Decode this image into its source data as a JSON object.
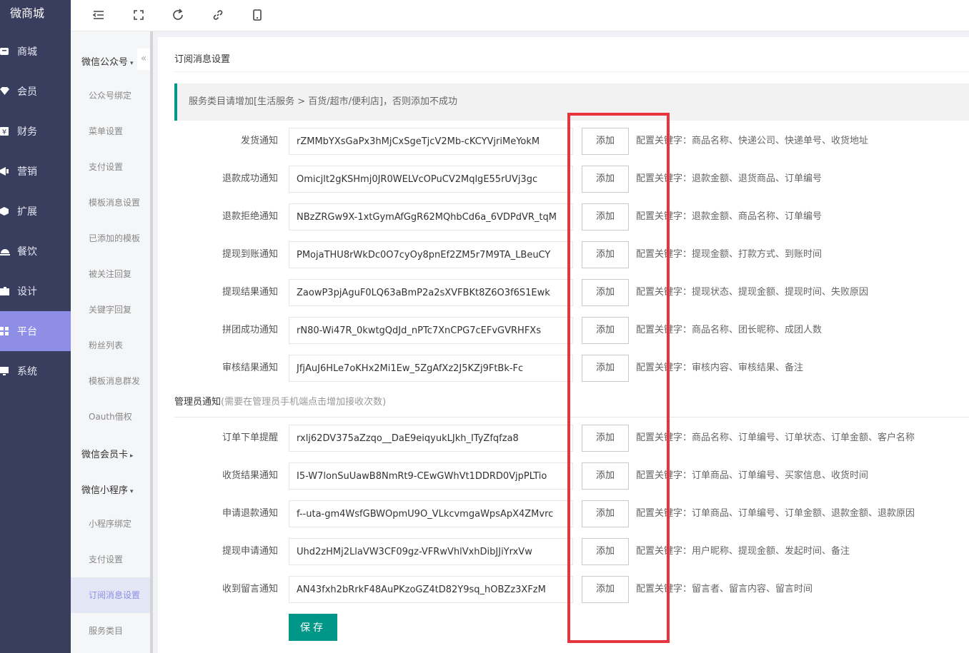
{
  "nav": {
    "brand": "微商城",
    "items": [
      {
        "label": "商城",
        "icon": "shop-icon"
      },
      {
        "label": "会员",
        "icon": "member-icon"
      },
      {
        "label": "财务",
        "icon": "finance-icon"
      },
      {
        "label": "营销",
        "icon": "marketing-icon"
      },
      {
        "label": "扩展",
        "icon": "extension-icon"
      },
      {
        "label": "餐饮",
        "icon": "catering-icon"
      },
      {
        "label": "设计",
        "icon": "design-icon"
      },
      {
        "label": "平台",
        "icon": "platform-icon",
        "active": true
      },
      {
        "label": "系统",
        "icon": "system-icon"
      }
    ]
  },
  "submenu": {
    "groups": [
      {
        "label": "微信公众号",
        "caret": "▾"
      },
      {
        "label": "微信会员卡",
        "caret": "▸"
      },
      {
        "label": "微信小程序",
        "caret": "▾"
      }
    ],
    "items": [
      "公众号绑定",
      "菜单设置",
      "支付设置",
      "模板消息设置",
      "已添加的模板",
      "被关注回复",
      "关键字回复",
      "粉丝列表",
      "模板消息群发",
      "Oauth借权",
      "小程序绑定",
      "支付设置",
      "订阅消息设置",
      "服务类目"
    ],
    "active_index": 12,
    "collapse_icon": "«"
  },
  "page": {
    "title": "订阅消息设置",
    "alert": "服务类目请增加[生活服务 > 百货/超市/便利店]，否则添加不成功",
    "add_label": "添加",
    "save_label": "保存",
    "section2_title": "管理员通知",
    "section2_hint": "(需要在管理员手机端点击增加接收次数)"
  },
  "user_notifications": [
    {
      "label": "发货通知",
      "value": "rZMMbYXsGaPx3hMjCxSgeTjcV2Mb-cKCYVjriMeYokM",
      "keywords": "配置关键字：商品名称、快递公司、快递单号、收货地址"
    },
    {
      "label": "退款成功通知",
      "value": "Omicjlt2gKSHmj0JR0WELVcOPuCV2MqlgE55rUVj3gc",
      "keywords": "配置关键字：退款金额、退货商品、订单编号"
    },
    {
      "label": "退款拒绝通知",
      "value": "NBzZRGw9X-1xtGymAfGgR62MQhbCd6a_6VDPdVR_tqM",
      "keywords": "配置关键字：退款金额、商品名称、订单编号"
    },
    {
      "label": "提现到账通知",
      "value": "PMojaTHU8rWkDc0O7cyOy8pnEf2ZM5r7M9TA_LBeuCY",
      "keywords": "配置关键字：提现金额、打款方式、到账时间"
    },
    {
      "label": "提现结果通知",
      "value": "ZaowP3pjAguF0LQ63aBmP2a2sXVFBKt8Z6O3f6S1Ewk",
      "keywords": "配置关键字：提现状态、提现金额、提现时间、失败原因"
    },
    {
      "label": "拼团成功通知",
      "value": "rN80-Wi47R_0kwtgQdJd_nPTc7XnCPG7cEFvGVRHFXs",
      "keywords": "配置关键字：商品名称、团长昵称、成团人数"
    },
    {
      "label": "审核结果通知",
      "value": "JfjAuJ6HLe7oKHx2Mi1Ew_5ZgAfXz2J5KZj9FtBk-Fc",
      "keywords": "配置关键字：审核内容、审核结果、备注"
    }
  ],
  "admin_notifications": [
    {
      "label": "订单下单提醒",
      "value": "rxlj62DV375aZzqo__DaE9eiqyukLJkh_ITyZfqfza8",
      "keywords": "配置关键字：商品名称、订单编号、订单状态、订单金额、客户名称"
    },
    {
      "label": "收货结果通知",
      "value": "I5-W7lonSuUawB8NmRt9-CEwGWhVt1DDRD0VjpPLTio",
      "keywords": "配置关键字：订单商品、订单编号、买家信息、收货时间"
    },
    {
      "label": "申请退款通知",
      "value": "f--uta-gm4WsfGBWOpmU9O_VLkcvmgaWpsApX4ZMvrc",
      "keywords": "配置关键字：订单商品、订单编号、订单金额、退款金额、退款原因"
    },
    {
      "label": "提现申请通知",
      "value": "Uhd2zHMj2LlaVW3CF09gz-VFRwVhlVxhDibJJiYrxVw",
      "keywords": "配置关键字：用户昵称、提现金额、发起时间、备注"
    },
    {
      "label": "收到留言通知",
      "value": "AN43fxh2bRrkF48AuPKzoGZ4tD82Y9sq_hOBZz3XFzM",
      "keywords": "配置关键字：留言者、留言内容、留言时间"
    }
  ],
  "colors": {
    "nav_bg": "#393d5e",
    "nav_active": "#8e8ee6",
    "primary": "#009688",
    "highlight": "#e8343f"
  }
}
